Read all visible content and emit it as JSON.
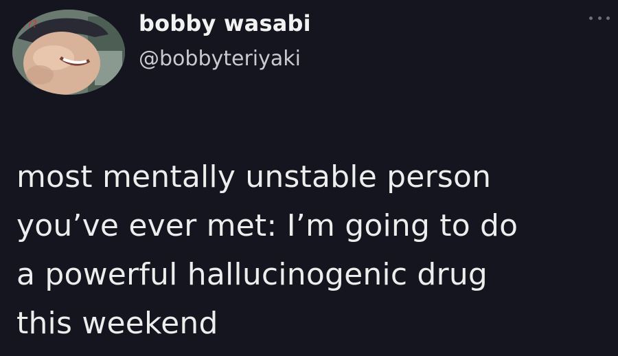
{
  "tweet": {
    "author": {
      "display_name": "bobby wasabi",
      "handle": "@bobbyteriyaki",
      "avatar_caption": "???"
    },
    "more_icon": "more-horizontal-icon",
    "text_lines": [
      "most mentally unstable person",
      "you’ve ever met: I’m going to do",
      "a powerful hallucinogenic drug",
      "this weekend"
    ]
  },
  "colors": {
    "background": "#15151f",
    "text": "#ededed",
    "handle": "#c9c9cf"
  }
}
